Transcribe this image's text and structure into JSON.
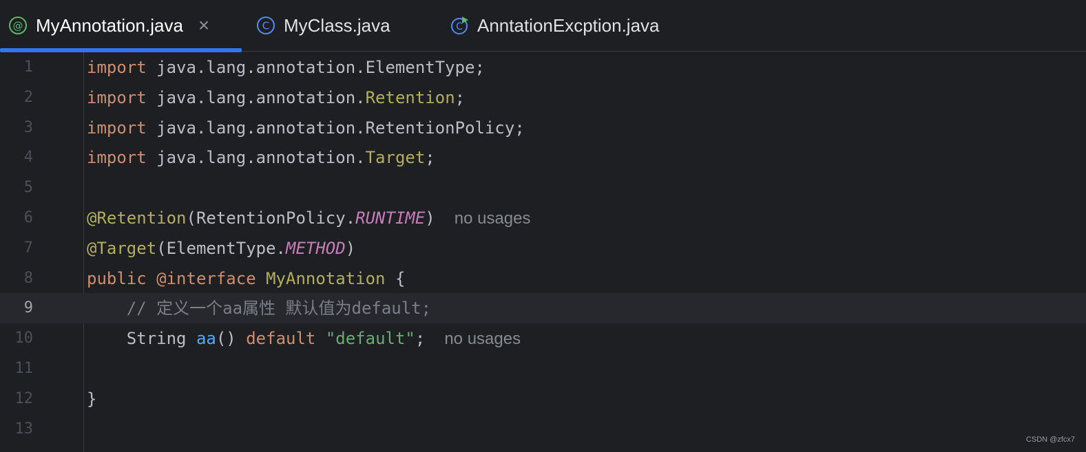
{
  "tabs": [
    {
      "label": "MyAnnotation.java",
      "icon": "annotation-icon",
      "active": true,
      "close": "×"
    },
    {
      "label": "MyClass.java",
      "icon": "class-icon",
      "active": false
    },
    {
      "label": "AnntationExcption.java",
      "icon": "runnable-class-icon",
      "active": false
    }
  ],
  "colors": {
    "accent": "#3574f0",
    "keyword": "#cf8e6d",
    "annotation": "#b3ae60",
    "constant": "#c77dbb",
    "method": "#56a8f5",
    "string": "#6aab73",
    "comment": "#7a7e85"
  },
  "editor": {
    "current_line": 9,
    "lines": [
      {
        "num": "1",
        "parts": [
          {
            "t": "import",
            "c": "kw"
          },
          {
            "t": " java.lang.annotation.ElementType;",
            "c": "pkg"
          }
        ]
      },
      {
        "num": "2",
        "parts": [
          {
            "t": "import",
            "c": "kw"
          },
          {
            "t": " java.lang.annotation.",
            "c": "pkg"
          },
          {
            "t": "Retention",
            "c": "yel"
          },
          {
            "t": ";",
            "c": "pkg"
          }
        ]
      },
      {
        "num": "3",
        "parts": [
          {
            "t": "import",
            "c": "kw"
          },
          {
            "t": " java.lang.annotation.RetentionPolicy;",
            "c": "pkg"
          }
        ]
      },
      {
        "num": "4",
        "parts": [
          {
            "t": "import",
            "c": "kw"
          },
          {
            "t": " java.lang.annotation.",
            "c": "pkg"
          },
          {
            "t": "Target",
            "c": "yel"
          },
          {
            "t": ";",
            "c": "pkg"
          }
        ]
      },
      {
        "num": "5",
        "parts": []
      },
      {
        "num": "6",
        "parts": [
          {
            "t": "@Retention",
            "c": "ann"
          },
          {
            "t": "(RetentionPolicy.",
            "c": "cls"
          },
          {
            "t": "RUNTIME",
            "c": "const"
          },
          {
            "t": ")",
            "c": "cls"
          }
        ],
        "hint": "no usages"
      },
      {
        "num": "7",
        "parts": [
          {
            "t": "@Target",
            "c": "ann"
          },
          {
            "t": "(ElementType.",
            "c": "cls"
          },
          {
            "t": "METHOD",
            "c": "const"
          },
          {
            "t": ")",
            "c": "cls"
          }
        ]
      },
      {
        "num": "8",
        "parts": [
          {
            "t": "public",
            "c": "kw"
          },
          {
            "t": " ",
            "c": "cls"
          },
          {
            "t": "@interface",
            "c": "kw"
          },
          {
            "t": " ",
            "c": "cls"
          },
          {
            "t": "MyAnnotation",
            "c": "yel"
          },
          {
            "t": " {",
            "c": "cls"
          }
        ]
      },
      {
        "num": "9",
        "parts": [
          {
            "t": "    // 定义一个aa属性 默认值为default;",
            "c": "cmt"
          }
        ]
      },
      {
        "num": "10",
        "parts": [
          {
            "t": "    String ",
            "c": "cls"
          },
          {
            "t": "aa",
            "c": "fn"
          },
          {
            "t": "() ",
            "c": "cls"
          },
          {
            "t": "default",
            "c": "kw"
          },
          {
            "t": " ",
            "c": "cls"
          },
          {
            "t": "\"default\"",
            "c": "str"
          },
          {
            "t": ";",
            "c": "cls"
          }
        ],
        "hint": "no usages"
      },
      {
        "num": "11",
        "parts": []
      },
      {
        "num": "12",
        "parts": [
          {
            "t": "}",
            "c": "cls"
          }
        ]
      },
      {
        "num": "13",
        "parts": []
      }
    ]
  },
  "watermark": "CSDN @zfcx7"
}
